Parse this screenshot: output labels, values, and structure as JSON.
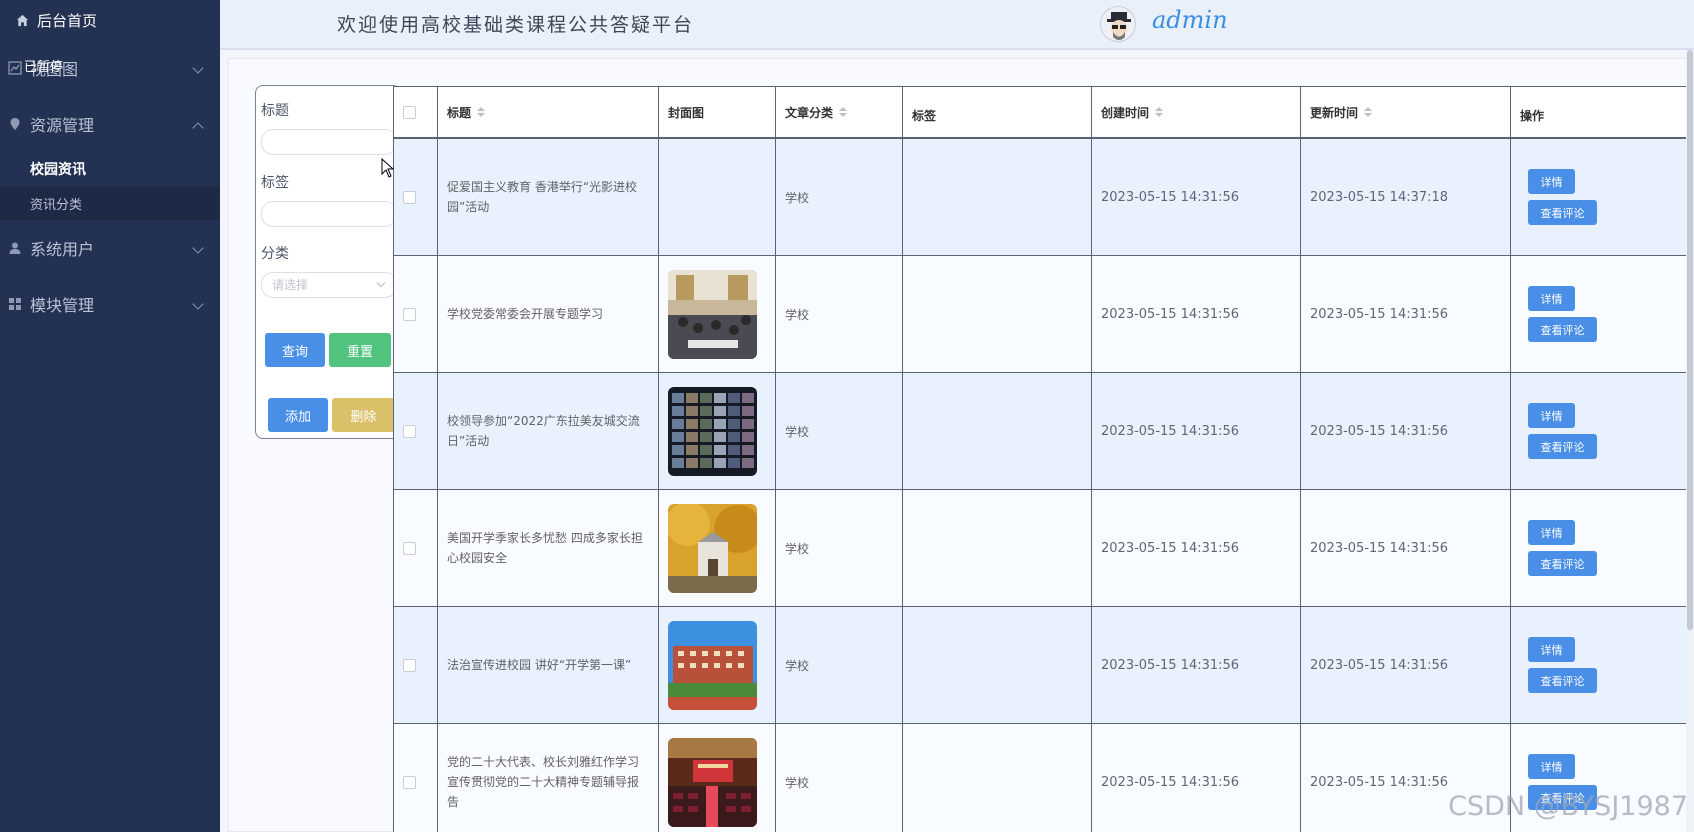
{
  "sidebar": {
    "home": "后台首页",
    "paused": "已暂停",
    "menus": [
      {
        "label": "视图图",
        "icon": "chart-icon",
        "expanded": false
      },
      {
        "label": "资源管理",
        "icon": "location-icon",
        "expanded": true
      },
      {
        "label": "系统用户",
        "icon": "user-icon",
        "expanded": false
      },
      {
        "label": "模块管理",
        "icon": "grid-icon",
        "expanded": false
      }
    ],
    "sub_items": [
      "校园资讯",
      "资讯分类"
    ]
  },
  "header": {
    "title": "欢迎使用高校基础类课程公共答疑平台",
    "user": "admin"
  },
  "search": {
    "title_label": "标题",
    "tag_label": "标签",
    "category_label": "分类",
    "category_placeholder": "请选择",
    "query_button": "查询",
    "reset_button": "重置",
    "add_button": "添加",
    "delete_button": "删除"
  },
  "table": {
    "headers": [
      "标题",
      "封面图",
      "文章分类",
      "标签",
      "创建时间",
      "更新时间",
      "操作"
    ],
    "detail_label": "详情",
    "comments_label": "查看评论",
    "rows": [
      {
        "title": "促爱国主义教育 香港举行“光影进校园”活动",
        "category": "学校",
        "tag": "",
        "created": "2023-05-15 14:31:56",
        "updated": "2023-05-15 14:37:18",
        "cover": "none"
      },
      {
        "title": "学校党委常委会开展专题学习",
        "category": "学校",
        "tag": "",
        "created": "2023-05-15 14:31:56",
        "updated": "2023-05-15 14:31:56",
        "cover": "meeting"
      },
      {
        "title": "校领导参加“2022广东拉美友城交流日”活动",
        "category": "学校",
        "tag": "",
        "created": "2023-05-15 14:31:56",
        "updated": "2023-05-15 14:31:56",
        "cover": "video-grid"
      },
      {
        "title": "美国开学季家长多忧愁 四成多家长担心校园安全",
        "category": "学校",
        "tag": "",
        "created": "2023-05-15 14:31:56",
        "updated": "2023-05-15 14:31:56",
        "cover": "autumn-campus"
      },
      {
        "title": "法治宣传进校园 讲好“开学第一课”",
        "category": "学校",
        "tag": "",
        "created": "2023-05-15 14:31:56",
        "updated": "2023-05-15 14:31:56",
        "cover": "building"
      },
      {
        "title": "党的二十大代表、校长刘雅红作学习宣传贯彻党的二十大精神专题辅导报告",
        "category": "学校",
        "tag": "",
        "created": "2023-05-15 14:31:56",
        "updated": "2023-05-15 14:31:56",
        "cover": "auditorium"
      }
    ]
  },
  "watermark": "CSDN @BYSJ1987"
}
